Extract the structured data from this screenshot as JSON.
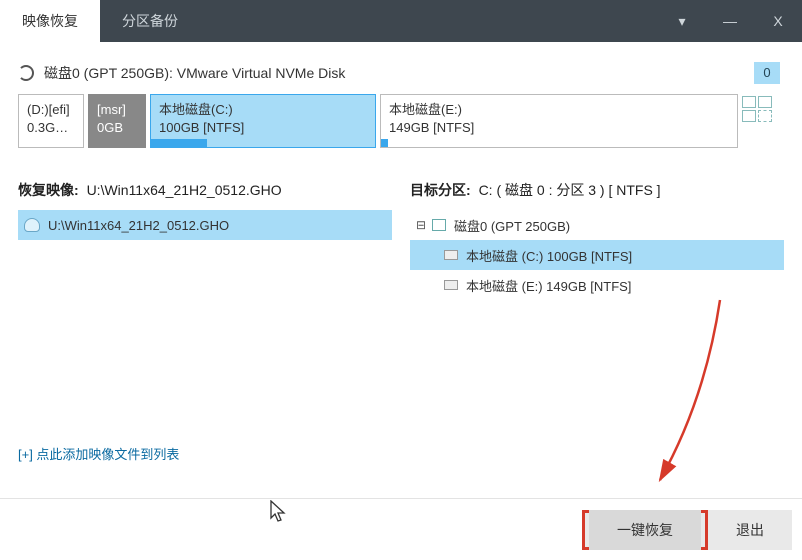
{
  "tabs": {
    "restore": "映像恢复",
    "backup": "分区备份"
  },
  "window": {
    "dropdown": "▾",
    "min": "—",
    "close": "X"
  },
  "disk": {
    "label": "磁盘0 (GPT 250GB): VMware Virtual NVMe Disk",
    "index": "0"
  },
  "partitions": [
    {
      "line1": "(D:)[efi]",
      "line2": "0.3G…",
      "widthPx": 66,
      "usagePct": 0,
      "kind": "efi"
    },
    {
      "line1": "[msr]",
      "line2": "0GB",
      "widthPx": 58,
      "usagePct": 0,
      "kind": "msr"
    },
    {
      "line1": "本地磁盘(C:)",
      "line2": "100GB [NTFS]",
      "widthPx": 226,
      "usagePct": 25,
      "kind": "sel"
    },
    {
      "line1": "本地磁盘(E:)",
      "line2": "149GB [NTFS]",
      "widthPx": 358,
      "usagePct": 2,
      "kind": "normal"
    }
  ],
  "left": {
    "title": "恢复映像:",
    "value": "U:\\Win11x64_21H2_0512.GHO",
    "items": [
      "U:\\Win11x64_21H2_0512.GHO"
    ],
    "addLink": "[+] 点此添加映像文件到列表"
  },
  "right": {
    "title": "目标分区:",
    "value": "C: ( 磁盘 0 : 分区 3 ) [ NTFS ]",
    "diskNode": "磁盘0 (GPT 250GB)",
    "drives": [
      {
        "label": "本地磁盘 (C:) 100GB [NTFS]",
        "selected": true
      },
      {
        "label": "本地磁盘 (E:) 149GB [NTFS]",
        "selected": false
      }
    ]
  },
  "footer": {
    "restore": "一键恢复",
    "exit": "退出"
  }
}
